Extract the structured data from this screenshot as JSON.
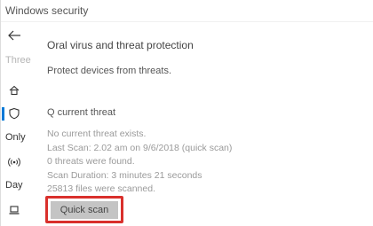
{
  "window": {
    "title": "Windows security"
  },
  "sidebar": {
    "back_icon": "back-arrow-icon",
    "labels": {
      "three": "Three",
      "only": "Only",
      "day": "Day"
    },
    "items": [
      {
        "icon": "home-icon"
      },
      {
        "icon": "shield-icon",
        "active": true
      },
      {
        "icon": "wireless-icon"
      },
      {
        "icon": "laptop-icon"
      }
    ],
    "accent_color": "#0078d7"
  },
  "main": {
    "heading": "Oral virus and threat protection",
    "subtitle": "Protect devices from threats.",
    "section_title": "Q current threat",
    "status_lines": [
      "No current threat exists.",
      "Last Scan: 2.02 am on 9/6/2018 (quick scan)",
      "0 threats were found.",
      "Scan Duration: 3 minutes 21 seconds",
      "25813 files were scanned."
    ],
    "quick_scan_label": "Quick scan",
    "highlight_color": "#d9302c"
  }
}
